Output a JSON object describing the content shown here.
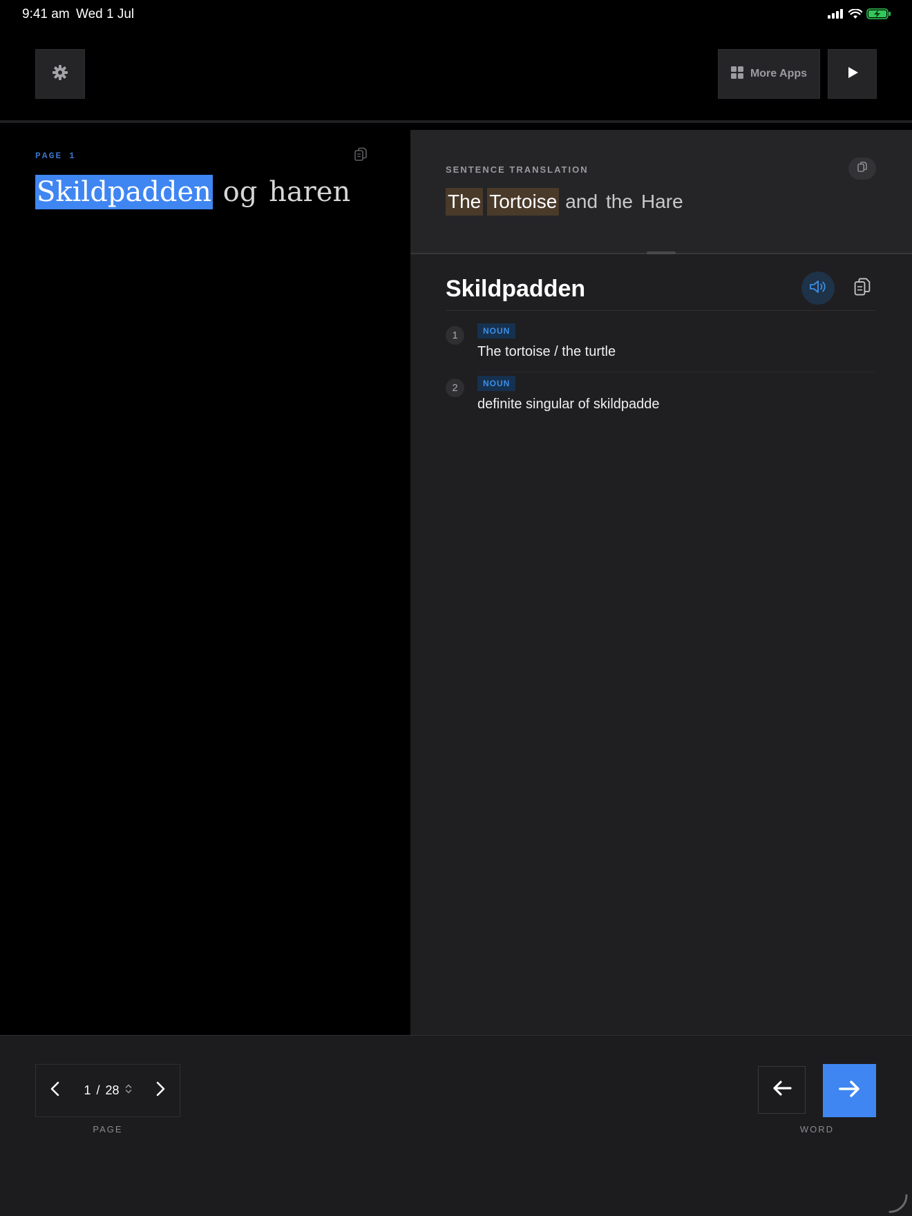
{
  "status_bar": {
    "time": "9:41 am",
    "date": "Wed 1 Jul",
    "icons": [
      "cellular-signal-icon",
      "wifi-icon",
      "battery-charging-icon"
    ]
  },
  "toolbar": {
    "settings_icon": "gear-icon",
    "more_apps_label": "More Apps",
    "more_apps_icon": "grid-icon",
    "play_icon": "play-icon"
  },
  "reader": {
    "page_label": "PAGE 1",
    "copy_icon": "copy-icon",
    "words": [
      {
        "text": "Skildpadden",
        "selected": true
      },
      {
        "text": "og",
        "selected": false
      },
      {
        "text": "haren",
        "selected": false
      }
    ]
  },
  "translation": {
    "label": "SENTENCE TRANSLATION",
    "words": [
      {
        "text": "The",
        "highlighted": true
      },
      {
        "text": "Tortoise",
        "highlighted": true
      },
      {
        "text": "and",
        "highlighted": false
      },
      {
        "text": "the",
        "highlighted": false
      },
      {
        "text": "Hare",
        "highlighted": false
      }
    ]
  },
  "dictionary": {
    "word": "Skildpadden",
    "speak_icon": "speaker-icon",
    "copy_icon": "copy-icon",
    "definitions": [
      {
        "number": "1",
        "pos": "NOUN",
        "text": "The tortoise / the turtle"
      },
      {
        "number": "2",
        "pos": "NOUN",
        "text": "definite singular of skildpadde"
      }
    ]
  },
  "page_navigation": {
    "current": "1",
    "separator": "/",
    "total": "28",
    "caption": "PAGE"
  },
  "word_navigation": {
    "caption": "WORD"
  },
  "colors": {
    "accent": "#3f86f2",
    "badge_text": "#3d8fe6",
    "translation_highlight": "#4a3a2a",
    "battery_green": "#32c759"
  }
}
